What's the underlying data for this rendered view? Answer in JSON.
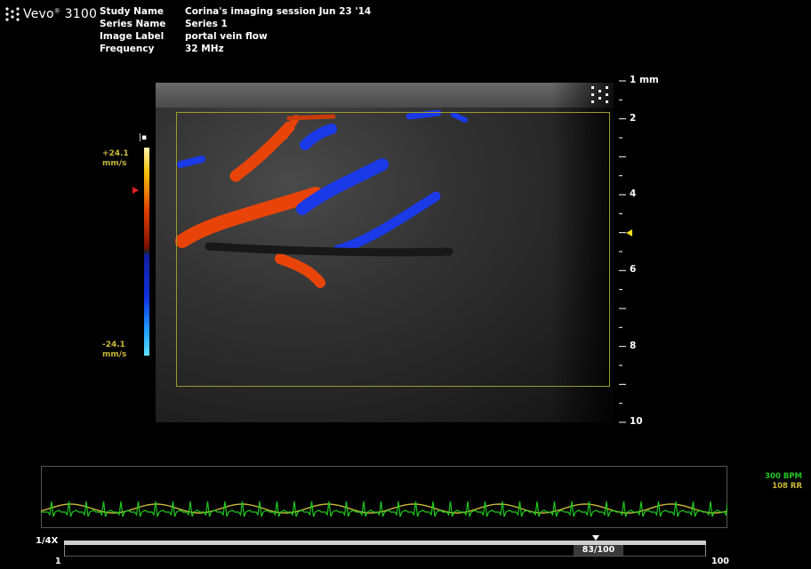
{
  "app": {
    "brand": "Vevo",
    "brand_sup": "®",
    "model": "3100"
  },
  "study": {
    "rows": [
      {
        "label": "Study Name",
        "value": "Corina's imaging session Jun 23 '14"
      },
      {
        "label": "Series Name",
        "value": "Series 1"
      },
      {
        "label": "Image Label",
        "value": "portal vein flow"
      },
      {
        "label": "Frequency",
        "value": "32 MHz"
      }
    ]
  },
  "color_scale": {
    "marker": "|▪",
    "top_value": "+24.1",
    "top_unit": "mm/s",
    "bottom_value": "-24.1",
    "bottom_unit": "mm/s"
  },
  "depth": {
    "labels": [
      {
        "value": 1,
        "text": "1 mm"
      },
      {
        "value": 2,
        "text": "2"
      },
      {
        "value": 4,
        "text": "4"
      },
      {
        "value": 6,
        "text": "6"
      },
      {
        "value": 8,
        "text": "8"
      },
      {
        "value": 10,
        "text": "10"
      }
    ],
    "min": 1,
    "max": 10,
    "focus_depth": 5
  },
  "physio": {
    "heart_rate": "300 BPM",
    "resp_rate": "108 RR",
    "ecg_color": "#1ec81e",
    "resp_color": "#c8b83a"
  },
  "playback": {
    "speed": "1/4X",
    "frame_counter": "83/100",
    "frame_start": "1",
    "frame_end": "100",
    "current_frame": 83,
    "total_frames": 100
  },
  "colors": {
    "flow_toward": "#e8440a",
    "flow_away": "#1a3ae8",
    "roi_box": "#9a9a2a"
  }
}
